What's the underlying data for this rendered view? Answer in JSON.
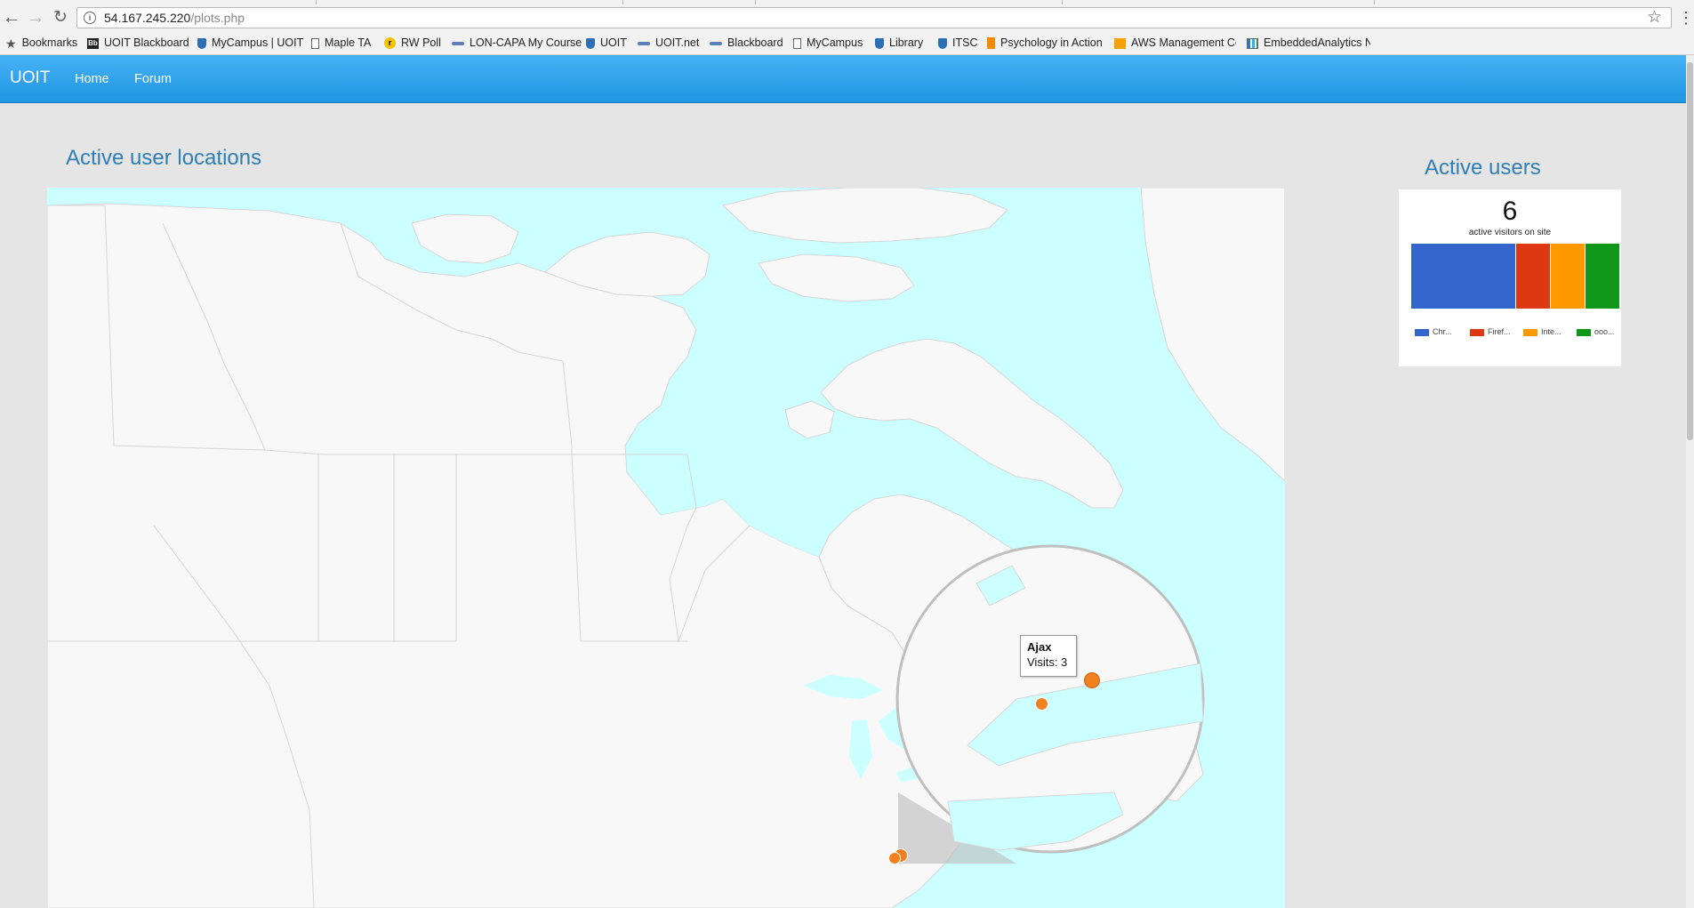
{
  "browser": {
    "url_host": "54.167.245.220",
    "url_path": "/plots.php",
    "bookmarks": [
      {
        "label": "Bookmarks",
        "icon": "star-icon"
      },
      {
        "label": "UOIT Blackboard",
        "icon": "blackboard-icon"
      },
      {
        "label": "MyCampus | UOIT",
        "icon": "shield-icon"
      },
      {
        "label": "Maple TA",
        "icon": "page-icon"
      },
      {
        "label": "RW Poll",
        "icon": "poll-icon"
      },
      {
        "label": "LON-CAPA My Course",
        "icon": "dash-icon"
      },
      {
        "label": "UOIT",
        "icon": "shield-icon"
      },
      {
        "label": "UOIT.net",
        "icon": "dash-icon"
      },
      {
        "label": "Blackboard",
        "icon": "dash-icon"
      },
      {
        "label": "MyCampus",
        "icon": "page-icon"
      },
      {
        "label": "Library",
        "icon": "shield-icon"
      },
      {
        "label": "ITSC",
        "icon": "shield-icon"
      },
      {
        "label": "Psychology in Action",
        "icon": "book-icon"
      },
      {
        "label": "AWS Management Co",
        "icon": "aws-icon"
      },
      {
        "label": "EmbeddedAnalytics N",
        "icon": "chart-icon"
      }
    ]
  },
  "navbar": {
    "brand": "UOIT",
    "links": [
      "Home",
      "Forum"
    ],
    "color": "#2a9fe8"
  },
  "map_panel": {
    "title": "Active user locations",
    "tooltip_city": "Ajax",
    "tooltip_visits": "Visits: 3",
    "marker_color": "#f08020"
  },
  "users_panel": {
    "title": "Active users",
    "count": "6",
    "count_label": "active visitors on site",
    "browsers": [
      {
        "label": "Chr...",
        "color": "#3366cc",
        "share": 0.5
      },
      {
        "label": "Firef...",
        "color": "#dc3912",
        "share": 0.1667
      },
      {
        "label": "Inte...",
        "color": "#ff9900",
        "share": 0.1667
      },
      {
        "label": "ooo...",
        "color": "#109618",
        "share": 0.1667
      }
    ]
  }
}
